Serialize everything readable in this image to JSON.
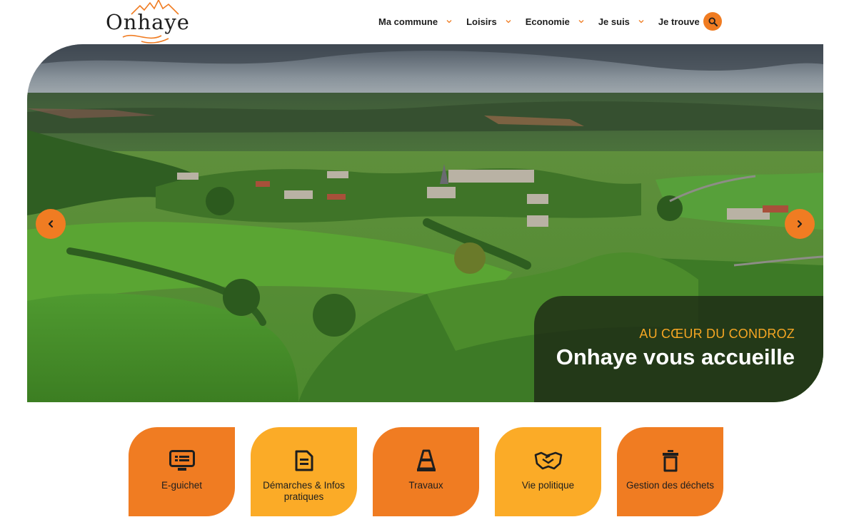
{
  "header": {
    "logo_text": "Onhaye",
    "nav": [
      {
        "label": "Ma commune"
      },
      {
        "label": "Loisirs"
      },
      {
        "label": "Economie"
      },
      {
        "label": "Je suis"
      },
      {
        "label": "Je trouve"
      }
    ],
    "search_icon": "search-icon"
  },
  "hero": {
    "kicker": "AU CŒUR DU CONDROZ",
    "title": "Onhaye vous accueille",
    "prev_icon": "chevron-left-icon",
    "next_icon": "chevron-right-icon"
  },
  "quick_links": [
    {
      "label": "E-guichet",
      "icon": "monitor-icon",
      "color": "orange"
    },
    {
      "label": "Démarches & Infos pratiques",
      "icon": "document-icon",
      "color": "yellow"
    },
    {
      "label": "Travaux",
      "icon": "traffic-cone-icon",
      "color": "orange"
    },
    {
      "label": "Vie politique",
      "icon": "handshake-icon",
      "color": "yellow"
    },
    {
      "label": "Gestion des déchets",
      "icon": "trash-bin-icon",
      "color": "orange"
    }
  ],
  "colors": {
    "accent": "#f07c22",
    "accent_light": "#fbab27",
    "kicker": "#f5a623"
  }
}
